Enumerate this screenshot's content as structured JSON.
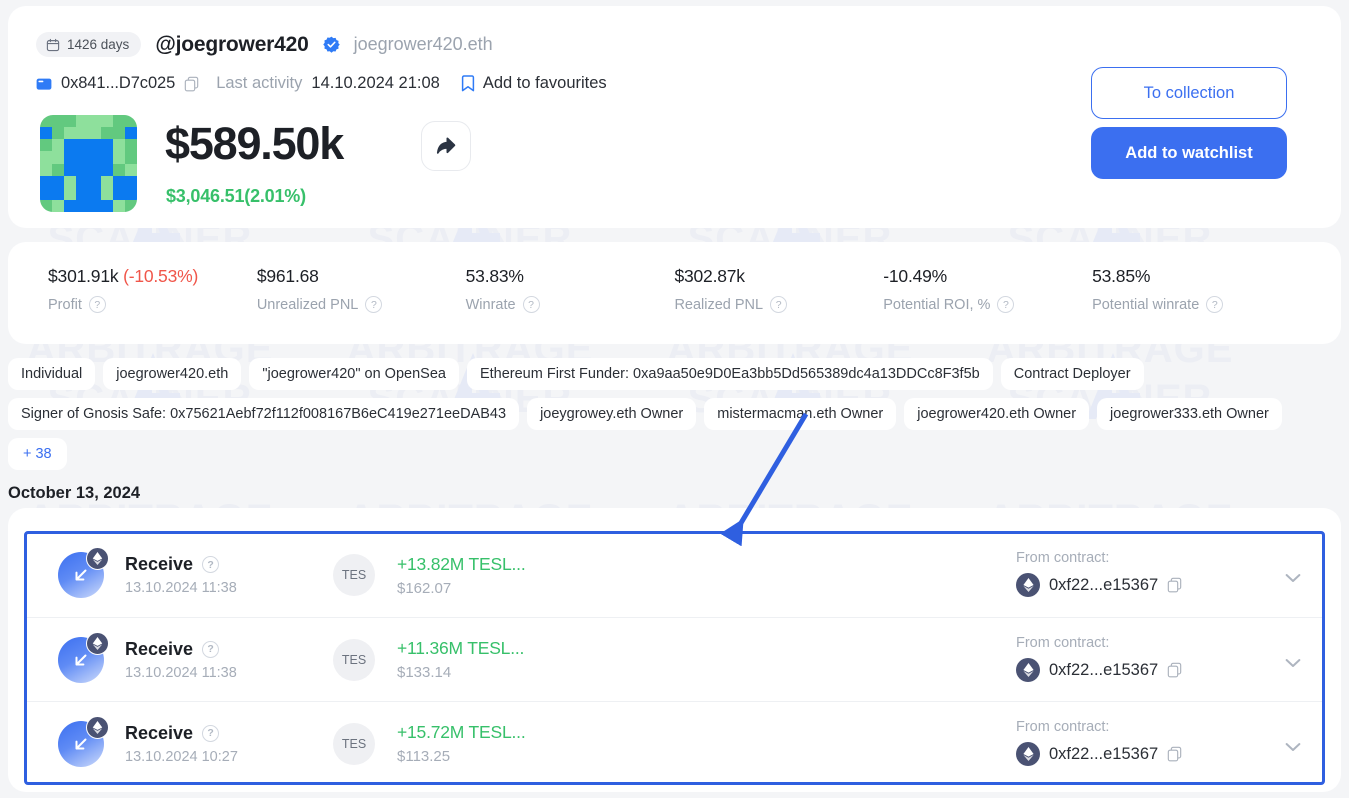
{
  "theme": {
    "accent": "#3b6ff0",
    "positive": "#37c06a",
    "negative": "#f0564a",
    "muted": "#9ba3ae",
    "page_bg": "#f4f5f7",
    "highlight_border": "#2f5fe0",
    "annotation_arrow": "#2f5fe0"
  },
  "watermark": {
    "line1": "ARBITRAGE",
    "line2": "SCANNER"
  },
  "profile": {
    "days_badge": "1426 days",
    "calendar_icon": "calendar-icon",
    "handle": "@joegrower420",
    "verified_icon": "verified-badge-icon",
    "ens_name": "joegrower420.eth",
    "wallet_icon": "wallet-icon",
    "address": "0x841...D7c025",
    "copy_icon": "copy-icon",
    "last_activity_label": "Last activity",
    "last_activity_value": "14.10.2024 21:08",
    "bookmark_icon": "bookmark-icon",
    "favourites_label": "Add to favourites",
    "avatar_icon": "pixel-avatar",
    "portfolio_value": "$589.50k",
    "share_icon": "share-icon",
    "change_value": "$3,046.51(2.01%)",
    "to_collection_label": "To collection",
    "add_watchlist_label": "Add to watchlist"
  },
  "stats": [
    {
      "value": "$301.91k",
      "delta": "(-10.53%)",
      "delta_sign": "negative",
      "label": "Profit",
      "help": "?"
    },
    {
      "value": "$961.68",
      "delta": "",
      "delta_sign": "none",
      "label": "Unrealized PNL",
      "help": "?"
    },
    {
      "value": "53.83%",
      "delta": "",
      "delta_sign": "none",
      "label": "Winrate",
      "help": "?"
    },
    {
      "value": "$302.87k",
      "delta": "",
      "delta_sign": "none",
      "label": "Realized PNL",
      "help": "?"
    },
    {
      "value": "-10.49%",
      "delta": "",
      "delta_sign": "none",
      "label": "Potential ROI, %",
      "help": "?"
    },
    {
      "value": "53.85%",
      "delta": "",
      "delta_sign": "none",
      "label": "Potential winrate",
      "help": "?"
    }
  ],
  "tags": [
    {
      "label": "Individual",
      "more": false
    },
    {
      "label": "joegrower420.eth",
      "more": false
    },
    {
      "label": "\"joegrower420\" on OpenSea",
      "more": false
    },
    {
      "label": "Ethereum First Funder: 0xa9aa50e9D0Ea3bb5Dd565389dc4a13DDCc8F3f5b",
      "more": false
    },
    {
      "label": "Contract Deployer",
      "more": false
    },
    {
      "label": "Signer of Gnosis Safe: 0x75621Aebf72f112f008167B6eC419e271eeDAB43",
      "more": false
    },
    {
      "label": "joeygrowey.eth Owner",
      "more": false
    },
    {
      "label": "mistermacman.eth Owner",
      "more": false
    },
    {
      "label": "joegrower420.eth Owner",
      "more": false
    },
    {
      "label": "joegrower333.eth Owner",
      "more": false
    },
    {
      "label": "+ 38",
      "more": true
    }
  ],
  "transactions": {
    "date_heading": "October 13, 2024",
    "rows": [
      {
        "direction_icon": "arrow-down-left-icon",
        "chain_icon": "ethereum-icon",
        "type": "Receive",
        "help": "?",
        "time": "13.10.2024 11:38",
        "token_symbol": "TES",
        "amount": "+13.82M TESL...",
        "usd": "$162.07",
        "from_label": "From contract:",
        "from_address": "0xf22...e15367",
        "copy_icon": "copy-icon",
        "chevron_icon": "chevron-down-icon"
      },
      {
        "direction_icon": "arrow-down-left-icon",
        "chain_icon": "ethereum-icon",
        "type": "Receive",
        "help": "?",
        "time": "13.10.2024 11:38",
        "token_symbol": "TES",
        "amount": "+11.36M TESL...",
        "usd": "$133.14",
        "from_label": "From contract:",
        "from_address": "0xf22...e15367",
        "copy_icon": "copy-icon",
        "chevron_icon": "chevron-down-icon"
      },
      {
        "direction_icon": "arrow-down-left-icon",
        "chain_icon": "ethereum-icon",
        "type": "Receive",
        "help": "?",
        "time": "13.10.2024 10:27",
        "token_symbol": "TES",
        "amount": "+15.72M TESL...",
        "usd": "$113.25",
        "from_label": "From contract:",
        "from_address": "0xf22...e15367",
        "copy_icon": "copy-icon",
        "chevron_icon": "chevron-down-icon"
      }
    ]
  },
  "avatar_pixels": [
    "ggggggggg",
    "bggggggb",
    "gggbbbbgg",
    "ggbbbbgg",
    "gbbbbbgg",
    "bgbbbgb",
    "bbbbbbbb",
    "gbbbbbbg"
  ]
}
